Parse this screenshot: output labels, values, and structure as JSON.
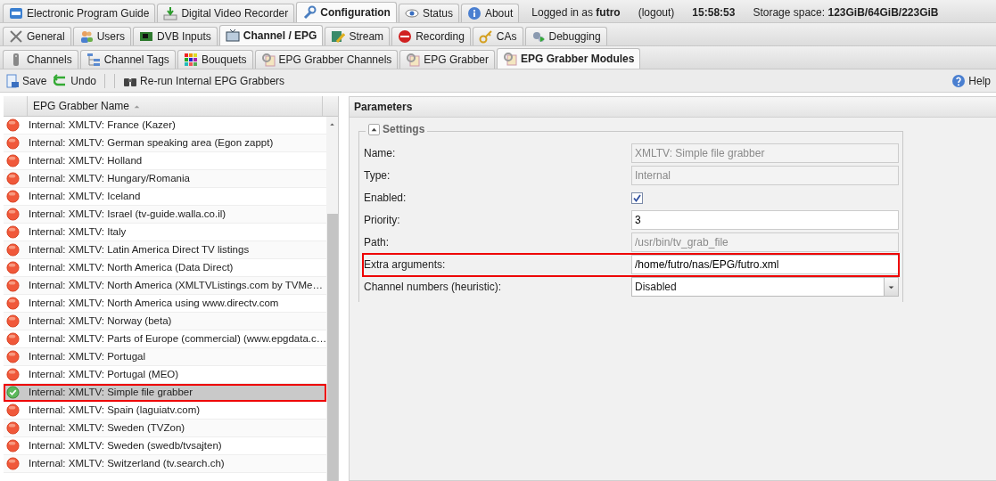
{
  "main_tabs": [
    {
      "label": "Electronic Program Guide",
      "selected": false
    },
    {
      "label": "Digital Video Recorder",
      "selected": false
    },
    {
      "label": "Configuration",
      "selected": true
    },
    {
      "label": "Status",
      "selected": false
    },
    {
      "label": "About",
      "selected": false
    }
  ],
  "header_info": {
    "logged_in_prefix": "Logged in as",
    "user": "futro",
    "logout": "(logout)",
    "time": "15:58:53",
    "storage_label": "Storage space:",
    "storage_value": "123GiB/64GiB/223GiB"
  },
  "config_tabs": [
    {
      "label": "General",
      "selected": false
    },
    {
      "label": "Users",
      "selected": false
    },
    {
      "label": "DVB Inputs",
      "selected": false
    },
    {
      "label": "Channel / EPG",
      "selected": true
    },
    {
      "label": "Stream",
      "selected": false
    },
    {
      "label": "Recording",
      "selected": false
    },
    {
      "label": "CAs",
      "selected": false
    },
    {
      "label": "Debugging",
      "selected": false
    }
  ],
  "epg_tabs": [
    {
      "label": "Channels",
      "selected": false
    },
    {
      "label": "Channel Tags",
      "selected": false
    },
    {
      "label": "Bouquets",
      "selected": false
    },
    {
      "label": "EPG Grabber Channels",
      "selected": false
    },
    {
      "label": "EPG Grabber",
      "selected": false
    },
    {
      "label": "EPG Grabber Modules",
      "selected": true
    }
  ],
  "toolbar": {
    "buttons": [
      "Save",
      "Undo",
      "Re-run Internal EPG Grabbers"
    ],
    "help": "Help"
  },
  "grid": {
    "column": "EPG Grabber Name",
    "rows": [
      {
        "name": "Internal: XMLTV: France (Kazer)",
        "enabled": false,
        "selected": false
      },
      {
        "name": "Internal: XMLTV: German speaking area (Egon zappt)",
        "enabled": false,
        "selected": false
      },
      {
        "name": "Internal: XMLTV: Holland",
        "enabled": false,
        "selected": false
      },
      {
        "name": "Internal: XMLTV: Hungary/Romania",
        "enabled": false,
        "selected": false
      },
      {
        "name": "Internal: XMLTV: Iceland",
        "enabled": false,
        "selected": false
      },
      {
        "name": "Internal: XMLTV: Israel (tv-guide.walla.co.il)",
        "enabled": false,
        "selected": false
      },
      {
        "name": "Internal: XMLTV: Italy",
        "enabled": false,
        "selected": false
      },
      {
        "name": "Internal: XMLTV: Latin America Direct TV listings",
        "enabled": false,
        "selected": false
      },
      {
        "name": "Internal: XMLTV: North America (Data Direct)",
        "enabled": false,
        "selected": false
      },
      {
        "name": "Internal: XMLTV: North America (XMLTVListings.com by TVMe…",
        "enabled": false,
        "selected": false
      },
      {
        "name": "Internal: XMLTV: North America using www.directv.com",
        "enabled": false,
        "selected": false
      },
      {
        "name": "Internal: XMLTV: Norway (beta)",
        "enabled": false,
        "selected": false
      },
      {
        "name": "Internal: XMLTV: Parts of Europe (commercial) (www.epgdata.c…",
        "enabled": false,
        "selected": false
      },
      {
        "name": "Internal: XMLTV: Portugal",
        "enabled": false,
        "selected": false
      },
      {
        "name": "Internal: XMLTV: Portugal (MEO)",
        "enabled": false,
        "selected": false
      },
      {
        "name": "Internal: XMLTV: Simple file grabber",
        "enabled": true,
        "selected": true
      },
      {
        "name": "Internal: XMLTV: Spain (laguiatv.com)",
        "enabled": false,
        "selected": false
      },
      {
        "name": "Internal: XMLTV: Sweden (TVZon)",
        "enabled": false,
        "selected": false
      },
      {
        "name": "Internal: XMLTV: Sweden (swedb/tvsajten)",
        "enabled": false,
        "selected": false
      },
      {
        "name": "Internal: XMLTV: Switzerland (tv.search.ch)",
        "enabled": false,
        "selected": false
      }
    ]
  },
  "parameters": {
    "title": "Parameters",
    "section": "Settings",
    "expanded": true,
    "fields": [
      {
        "kind": "text",
        "label": "Name:",
        "value": "XMLTV: Simple file grabber",
        "disabled": true,
        "highlighted": false
      },
      {
        "kind": "text",
        "label": "Type:",
        "value": "Internal",
        "disabled": true,
        "highlighted": false
      },
      {
        "kind": "checkbox",
        "label": "Enabled:",
        "checked": true,
        "highlighted": false
      },
      {
        "kind": "text",
        "label": "Priority:",
        "value": "3",
        "disabled": false,
        "highlighted": false
      },
      {
        "kind": "text",
        "label": "Path:",
        "value": "/usr/bin/tv_grab_file",
        "disabled": true,
        "highlighted": false
      },
      {
        "kind": "text",
        "label": "Extra arguments:",
        "value": "/home/futro/nas/EPG/futro.xml",
        "disabled": false,
        "highlighted": true
      },
      {
        "kind": "select",
        "label": "Channel numbers (heuristic):",
        "value": "Disabled",
        "highlighted": false
      }
    ]
  }
}
